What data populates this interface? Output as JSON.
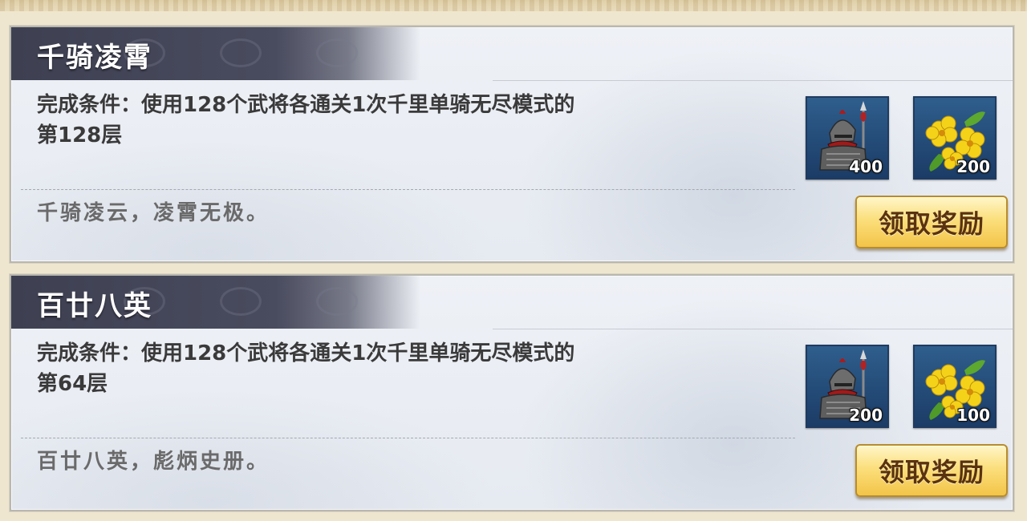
{
  "achievements": [
    {
      "title": "千骑凌霄",
      "condition_line1": "完成条件：使用128个武将各通关1次千里单骑无尽模式的",
      "condition_line2": "第128层",
      "flavor": "千骑凌云，凌霄无极。",
      "rewards": [
        {
          "icon": "armor-icon",
          "quantity": "400"
        },
        {
          "icon": "yellow-flower-icon",
          "quantity": "200"
        }
      ],
      "claim_label": "领取奖励"
    },
    {
      "title": "百廿八英",
      "condition_line1": "完成条件：使用128个武将各通关1次千里单骑无尽模式的",
      "condition_line2": "第64层",
      "flavor": "百廿八英，彪炳史册。",
      "rewards": [
        {
          "icon": "armor-icon",
          "quantity": "200"
        },
        {
          "icon": "yellow-flower-icon",
          "quantity": "100"
        }
      ],
      "claim_label": "领取奖励"
    }
  ]
}
